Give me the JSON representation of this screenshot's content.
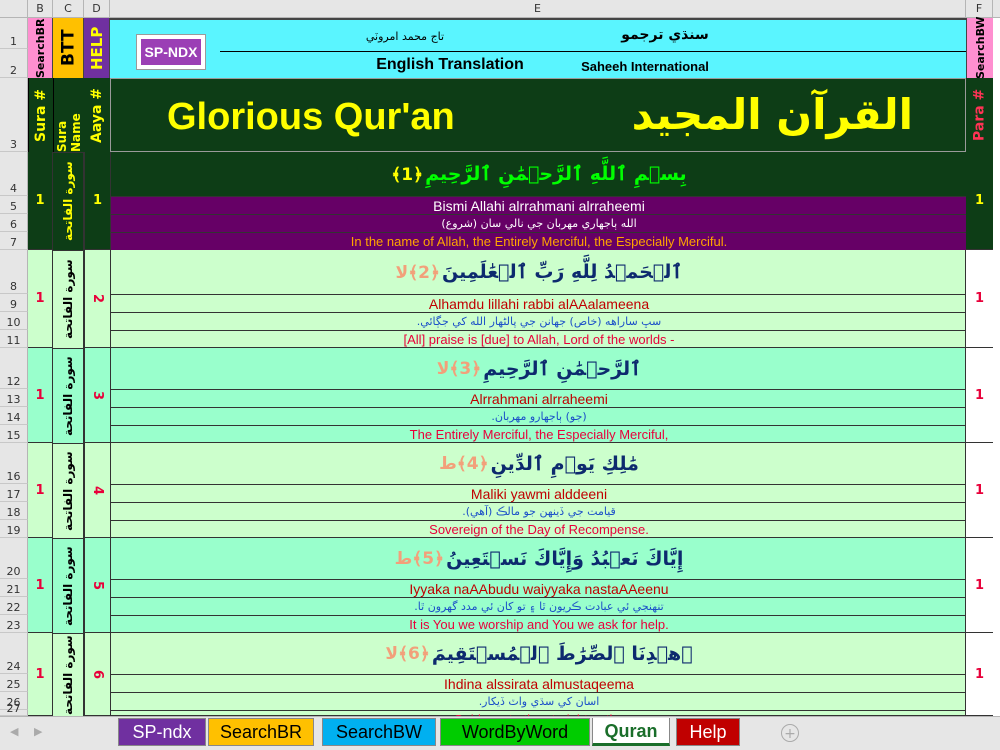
{
  "columns": [
    "B",
    "C",
    "D",
    "E",
    "F"
  ],
  "rows": [
    "1",
    "2",
    "3",
    "4",
    "5",
    "6",
    "7",
    "8",
    "9",
    "10",
    "11",
    "12",
    "13",
    "14",
    "15",
    "16",
    "17",
    "18",
    "19",
    "20",
    "21",
    "22",
    "23",
    "24",
    "25",
    "26",
    "27"
  ],
  "header": {
    "searchbr_btn": "SearchBR",
    "btt_btn": "BTT",
    "help_btn": "HELP",
    "spndx_btn": "SP-NDX",
    "author": "تاج محمد امروٽي",
    "sindhi_title": "سنڌي ترجمو",
    "english_translation": "English Translation",
    "saheeh": "Saheeh International",
    "searchbw_btn": "SearchBW"
  },
  "banner": {
    "sura_no": "Sura #",
    "sura_name": "Sura Name",
    "aaya_no": "Aaya #",
    "title_en": "Glorious Qur'an",
    "title_ar": "القرآن المجيد",
    "para_no": "Para #"
  },
  "verses": [
    {
      "sura": "1",
      "sura_name": "سورة الفاتحة",
      "aaya": "1",
      "para": "1",
      "arabic": "بِسۡمِ ٱللَّهِ ٱلرَّحۡمَٰنِ ٱلرَّحِيمِ",
      "marker": "﴿1﴾",
      "translit": "Bismi Allahi alrrahmani alrraheemi",
      "sindhi": "الله ٻاجھاري مھربان جي نالي سان (شروع)",
      "english": "In the name of Allah, the Entirely Merciful, the Especially Merciful."
    },
    {
      "sura": "1",
      "sura_name": "سورة الفاتحة",
      "aaya": "2",
      "para": "1",
      "arabic": "ٱلۡحَمۡدُ لِلَّهِ رَبِّ ٱلۡعَٰلَمِينَ",
      "marker": "﴿2﴾لا",
      "translit": "Alhamdu lillahi rabbi alAAalameena",
      "sindhi": "سڀ ساراهه (خاص) جھانن جي پالڻھار الله کي جڳائي.",
      "english": "[All] praise is [due] to Allah, Lord of the worlds -"
    },
    {
      "sura": "1",
      "sura_name": "سورة الفاتحة",
      "aaya": "3",
      "para": "1",
      "arabic": "ٱلرَّحۡمَٰنِ ٱلرَّحِيمِ",
      "marker": "﴿3﴾لا",
      "translit": "Alrrahmani alrraheemi",
      "sindhi": "(جو) ٻاجھارو مھربان.",
      "english": "The Entirely Merciful, the Especially Merciful,"
    },
    {
      "sura": "1",
      "sura_name": "سورة الفاتحة",
      "aaya": "4",
      "para": "1",
      "arabic": "مَٰلِكِ يَوۡمِ ٱلدِّينِ",
      "marker": "﴿4﴾ط",
      "translit": "Maliki yawmi alddeeni",
      "sindhi": "قيامت جي ڏينھن جو مالڪ (آھي).",
      "english": "Sovereign of the Day of Recompense."
    },
    {
      "sura": "1",
      "sura_name": "سورة الفاتحة",
      "aaya": "5",
      "para": "1",
      "arabic": "إِيَّاكَ نَعۡبُدُ وَإِيَّاكَ نَسۡتَعِينُ",
      "marker": "﴿5﴾ط",
      "translit": "Iyyaka naAAbudu waiyyaka nastaAAeenu",
      "sindhi": "تنھنجي ئي عبادت ڪريون ٿا ۽ تو کان ئي مدد گھرون ٿا.",
      "english": "It is You we worship and You we ask for help."
    },
    {
      "sura": "1",
      "sura_name": "سورة الفاتحة",
      "aaya": "6",
      "para": "1",
      "arabic": "ٱهۡدِنَا ٱلصِّرَٰطَ ٱلۡمُسۡتَقِيمَ",
      "marker": "﴿6﴾لا",
      "translit": "Ihdina alssirata almustaqeema",
      "sindhi": "اسان کي سڌي واٽ ڏيکار.",
      "english": "Guide us to the straight path -"
    }
  ],
  "tabs": [
    {
      "label": "SP-ndx",
      "bg": "#7030a0",
      "fg": "#ffffff"
    },
    {
      "label": "SearchBR",
      "bg": "#ffc000",
      "fg": "#000000"
    },
    {
      "label": "SearchBW",
      "bg": "#00b0f0",
      "fg": "#000000"
    },
    {
      "label": "WordByWord",
      "bg": "#00cc00",
      "fg": "#000000"
    },
    {
      "label": "Quran",
      "bg": "#ffffff",
      "fg": "#1a6e2a"
    },
    {
      "label": "Help",
      "bg": "#c00000",
      "fg": "#ffffff"
    }
  ],
  "colors": {
    "header_cyan": "#5af5ff",
    "dark_green": "#0d3d16",
    "purple": "#660066",
    "mint_a": "#ccffcc",
    "mint_b": "#99ffcc",
    "accent_yellow": "#ffff00",
    "accent_red": "#e8003a"
  }
}
